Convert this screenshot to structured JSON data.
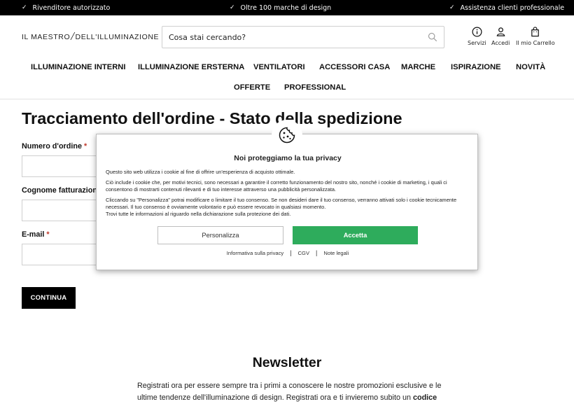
{
  "topbar": {
    "items": [
      "Rivenditore autorizzato",
      "Oltre 100 marche di design",
      "Assistenza clienti professionale"
    ]
  },
  "header": {
    "logo_left": "IL MAESTRO",
    "logo_right": "DELL'ILLUMINAZIONE",
    "search_placeholder": "Cosa stai cercando?",
    "icons": {
      "servizi": "Servizi",
      "accedi": "Accedi",
      "carrello": "Il mio Carrello"
    }
  },
  "nav": {
    "row1": [
      "ILLUMINAZIONE INTERNI",
      "ILLUMINAZIONE ERSTERNA",
      "VENTILATORI",
      "ACCESSORI CASA",
      "MARCHE",
      "ISPIRAZIONE",
      "NOVITÀ"
    ],
    "row2": [
      "OFFERTE",
      "PROFESSIONAL"
    ]
  },
  "main": {
    "title": "Tracciamento dell'ordine - Stato della spedizione",
    "fields": {
      "order_number": "Numero d'ordine",
      "billing_surname": "Cognome fatturazione",
      "email": "E-mail",
      "required_mark": "*"
    },
    "continue_label": "CONTINUA"
  },
  "newsletter": {
    "title": "Newsletter",
    "text": "Registrati ora per essere sempre tra i primi a conoscere le nostre promozioni esclusive e le ultime tendenze dell'illuminazione di design. Registrati ora e ti invieremo subito un",
    "text_bold": "codice"
  },
  "cookie_modal": {
    "title": "Noi proteggiamo la tua privacy",
    "p1": "Questo sito web utilizza i cookie al fine di offrire un'esperienza di acquisto ottimale.",
    "p2": "Ciò include i cookie che, per motivi tecnici, sono necessari a garantire il corretto funzionamento del nostro sito, nonché i cookie di marketing, i quali ci consentono di mostrarti contenuti rilevanti e di tuo interesse attraverso una pubblicità personalizzata.",
    "p3": "Cliccando su \"Personalizza\" potrai modificare o limitare il tuo consenso. Se non desideri dare il tuo consenso, verranno attivati solo i cookie tecnicamente necessari. Il tuo consenso è ovviamente volontario e può essere revocato in qualsiasi momento.",
    "p4": "Trovi tutte le informazioni al riguardo nella dichiarazione sulla protezione dei dati.",
    "btn_customize": "Personalizza",
    "btn_accept": "Accetta",
    "links": [
      "Informativa sulla privacy",
      "CGV",
      "Note legali"
    ]
  },
  "colors": {
    "accent_green": "#2eac5c",
    "topbar_bg": "#000000",
    "required_red": "#c0392b"
  }
}
